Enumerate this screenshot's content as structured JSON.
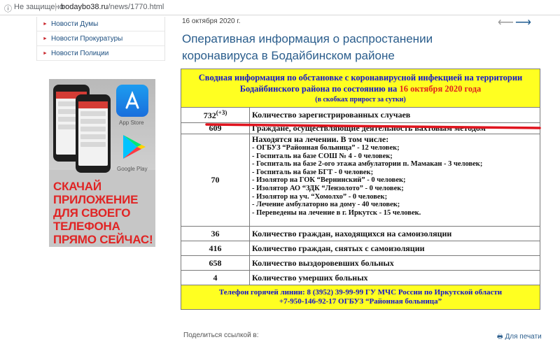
{
  "browser": {
    "info_icon": "info-icon",
    "insecure_label": "Не защищено",
    "separator": "|",
    "domain": "bodaybo38.ru",
    "path": "/news/1770.html"
  },
  "sidebar": {
    "items": [
      {
        "label": "Новости Думы"
      },
      {
        "label": "Новости Прокуратуры"
      },
      {
        "label": "Новости Полиции"
      }
    ],
    "ad": {
      "app_store_label": "App Store",
      "google_play_label": "Google Play",
      "slogan": "СКАЧАЙ ПРИЛОЖЕНИЕ ДЛЯ СВОЕГО ТЕЛЕФОНА ПРЯМО СЕЙЧАС!"
    }
  },
  "article": {
    "date": "16 октября 2020 г.",
    "prev_arrow": "⟵",
    "next_arrow": "⟶",
    "title": "Оперативная информация о распростанении коронавируса в Бодайбинском районе"
  },
  "report": {
    "header_line1": "Сводная информация по обстановке с коронавирусной инфекцией на территории Бодайбинского района по состоянию на",
    "header_date": "16 октября 2020 года",
    "header_line3": "(в скобках прирост за сутки)",
    "rows": {
      "cases": {
        "num": "732",
        "delta": "(+3)",
        "desc": "Количество зарегистрированных случаев"
      },
      "shift": {
        "num": "609",
        "desc": "Граждане, осуществляющие деятельность вахтовым методом"
      },
      "treatment": {
        "num": "70",
        "head": "Находятся на лечении. В том числе:",
        "lines": [
          "- ОГБУЗ “Районная больница” - 12 человек;",
          "- Госпиталь на базе СОШ № 4 -  0 человек;",
          "- Госпиталь на базе 2-ого этажа амбулатории п. Мамакан - 3 человек;",
          "- Госпиталь на базе БГТ - 0 человек;",
          "- Изолятор на ГОК “Вернинский” - 0 человек;",
          "- Изолятор АО “ЗДК “Лензолото” - 0 человек;",
          "- Изолятор на уч. “Хомолхо” - 0 человек;",
          "- Лечение амбулаторно на дому -  40   человек;",
          "- Переведены на лечение в г. Иркутск - 15 человек."
        ]
      },
      "isolation": {
        "num": "36",
        "desc": "Количество граждан, находящихся на самоизоляции"
      },
      "released": {
        "num": "416",
        "desc": "Количество граждан, снятых с самоизоляции"
      },
      "recovered": {
        "num": "658",
        "desc": "Количество выздоровевших больных"
      },
      "deaths": {
        "num": "4",
        "desc": "Количество умерших больных"
      }
    },
    "hotline_line1": "Телефон горячей линии: 8 (3952) 39-99-99   ГУ МЧС России по Иркутской области",
    "hotline_line2": "+7-950-146-92-17  ОГБУЗ “Районная больница”"
  },
  "footer": {
    "share_label": "Поделиться ссылкой в:",
    "print_label": "Для печати",
    "print_icon": "print-icon"
  },
  "colors": {
    "link": "#2a5d8c",
    "highlight": "#ffff21",
    "report_blue": "#1414cc",
    "alert_red": "#e02020"
  }
}
